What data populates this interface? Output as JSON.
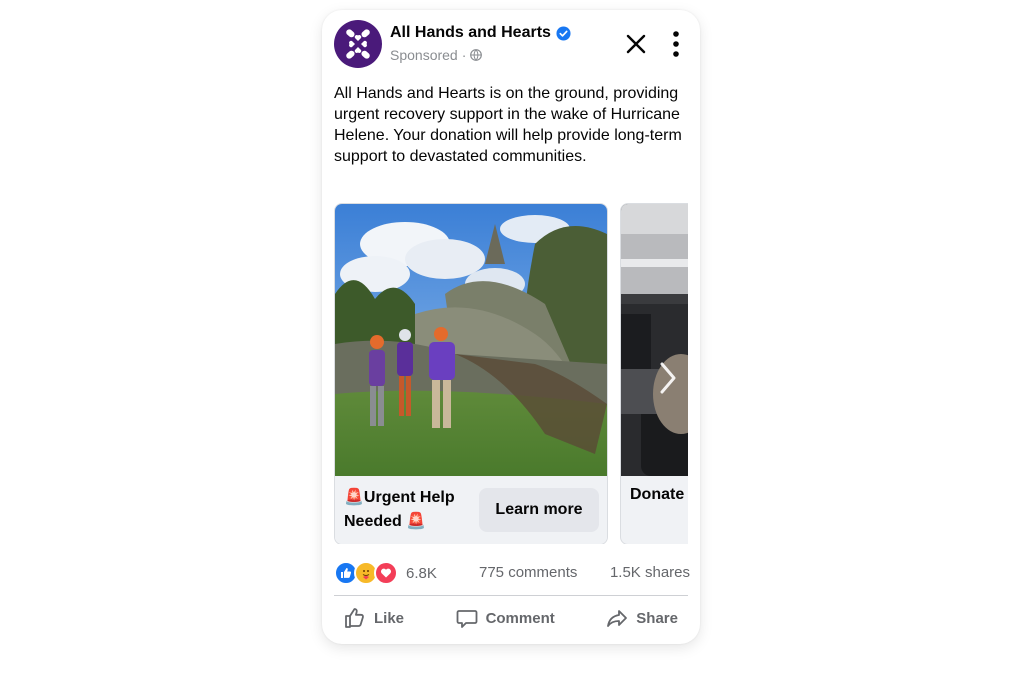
{
  "post": {
    "page_name": "All Hands and Hearts",
    "sponsored_label": "Sponsored",
    "separator": "·",
    "body": "All Hands and Hearts is on the ground, providing urgent recovery support in the wake of Hurricane Helene. Your donation will help provide long-term support to devastated communities."
  },
  "carousel": {
    "cards": [
      {
        "headline": "🚨Urgent Help Needed 🚨",
        "cta": "Learn more",
        "image": "volunteers-fallen-tree-photo"
      },
      {
        "headline": "Donate",
        "image": "office-room-photo"
      }
    ]
  },
  "engagement": {
    "reaction_icons": [
      "like-icon",
      "care-icon",
      "love-icon"
    ],
    "reaction_count": "6.8K",
    "comments": "775 comments",
    "shares": "1.5K shares"
  },
  "actions": {
    "like": "Like",
    "comment": "Comment",
    "share": "Share"
  },
  "colors": {
    "brand_purple": "#4a1a7a",
    "verified_blue": "#1877f2",
    "muted_text": "#65676b"
  }
}
